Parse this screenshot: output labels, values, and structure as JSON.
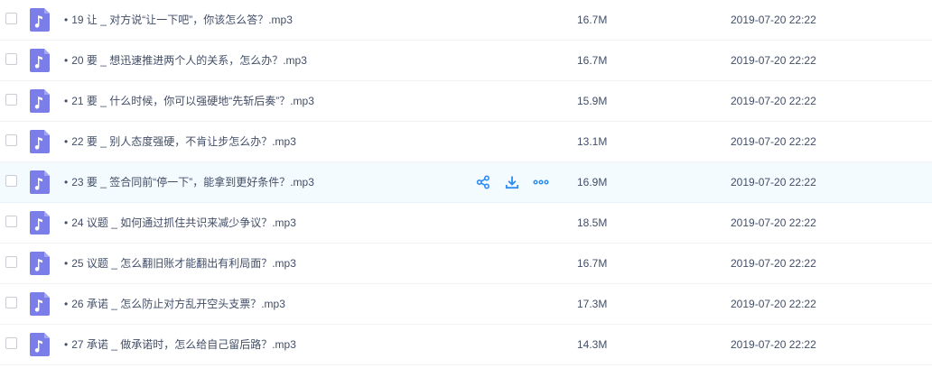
{
  "files": [
    {
      "name": "19 让 _ 对方说“让一下吧”，你该怎么答？.mp3",
      "size": "16.7M",
      "date": "2019-07-20 22:22"
    },
    {
      "name": "20 要 _ 想迅速推进两个人的关系，怎么办？.mp3",
      "size": "16.7M",
      "date": "2019-07-20 22:22"
    },
    {
      "name": "21 要 _ 什么时候，你可以强硬地“先斩后奏”？.mp3",
      "size": "15.9M",
      "date": "2019-07-20 22:22"
    },
    {
      "name": "22 要 _ 别人态度强硬，不肯让步怎么办？.mp3",
      "size": "13.1M",
      "date": "2019-07-20 22:22"
    },
    {
      "name": "23 要 _ 签合同前“停一下”，能拿到更好条件？.mp3",
      "size": "16.9M",
      "date": "2019-07-20 22:22"
    },
    {
      "name": "24 议题 _ 如何通过抓住共识来减少争议？.mp3",
      "size": "18.5M",
      "date": "2019-07-20 22:22"
    },
    {
      "name": "25 议题 _ 怎么翻旧账才能翻出有利局面？.mp3",
      "size": "16.7M",
      "date": "2019-07-20 22:22"
    },
    {
      "name": "26 承诺 _ 怎么防止对方乱开空头支票？.mp3",
      "size": "17.3M",
      "date": "2019-07-20 22:22"
    },
    {
      "name": "27 承诺 _ 做承诺时，怎么给自己留后路？.mp3",
      "size": "14.3M",
      "date": "2019-07-20 22:22"
    }
  ],
  "hover_index": 4,
  "colors": {
    "icon_bg": "#7b7ee8",
    "accent": "#2d8cf0",
    "hover_bg": "#f4fbff"
  },
  "icons": {
    "file": "music-note-icon",
    "share": "share-icon",
    "download": "download-icon",
    "more": "more-icon"
  }
}
